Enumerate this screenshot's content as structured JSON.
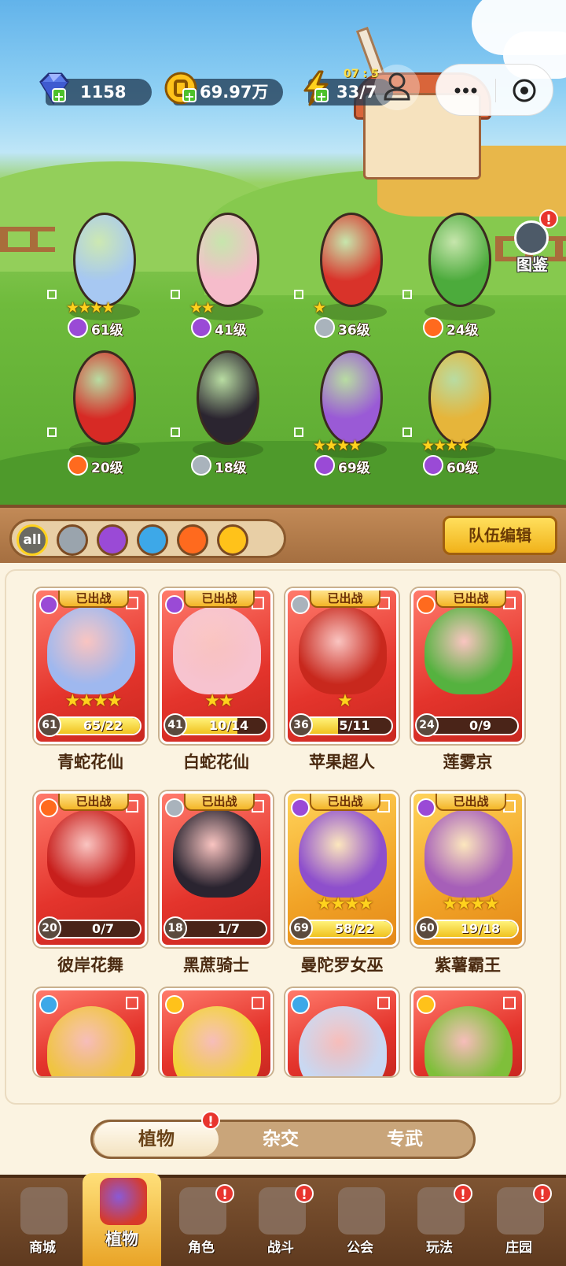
{
  "resources": {
    "gems": "1158",
    "gold": "69.97万",
    "stamina": "33/7",
    "stamina_timer": "07 : 5"
  },
  "codex": {
    "label": "图鉴",
    "badge": "!"
  },
  "lineup": [
    {
      "name": "青蛇花仙",
      "level": "61级",
      "stars": "★★★★",
      "element": "potion",
      "color": "#a7c8f2"
    },
    {
      "name": "白蛇花仙",
      "level": "41级",
      "stars": "★★",
      "element": "potion",
      "color": "#f6bccb"
    },
    {
      "name": "苹果超人",
      "level": "36级",
      "stars": "★",
      "element": "sword",
      "color": "#d9332a"
    },
    {
      "name": "莲雾京",
      "level": "24级",
      "stars": "",
      "element": "fire",
      "color": "#4cab3c"
    },
    {
      "name": "彼岸花舞",
      "level": "20级",
      "stars": "",
      "element": "fire",
      "color": "#d72a25"
    },
    {
      "name": "黑蔗骑士",
      "level": "18级",
      "stars": "",
      "element": "sword",
      "color": "#2b2530"
    },
    {
      "name": "曼陀罗女巫",
      "level": "69级",
      "stars": "★★★★",
      "element": "potion",
      "color": "#9a5ad6"
    },
    {
      "name": "紫薯霸王",
      "level": "60级",
      "stars": "★★★★",
      "element": "potion",
      "color": "#e6b53a"
    }
  ],
  "filters": [
    {
      "id": "all",
      "label": "all",
      "color": "#6b6a63"
    },
    {
      "id": "sword",
      "label": "",
      "color": "#9aa4ad"
    },
    {
      "id": "potion",
      "label": "",
      "color": "#9a4ad6"
    },
    {
      "id": "water",
      "label": "",
      "color": "#3da8e8"
    },
    {
      "id": "fire",
      "label": "",
      "color": "#ff6a1e"
    },
    {
      "id": "lightning",
      "label": "",
      "color": "#ffc21a"
    }
  ],
  "team_edit": "队伍编辑",
  "deployed_label": "已出战",
  "cards": [
    {
      "name": "青蛇花仙",
      "level": "61",
      "progress": "65/22",
      "fill": 1.0,
      "stars": "★★★★",
      "element": "potion",
      "bg": "red",
      "art": "#9fb8ef"
    },
    {
      "name": "白蛇花仙",
      "level": "41",
      "progress": "10/14",
      "fill": 0.71,
      "stars": "★★",
      "element": "potion",
      "bg": "red",
      "art": "#f7c3cf"
    },
    {
      "name": "苹果超人",
      "level": "36",
      "progress": "5/11",
      "fill": 0.45,
      "stars": "★",
      "element": "sword",
      "bg": "red",
      "art": "#c8281d"
    },
    {
      "name": "莲雾京",
      "level": "24",
      "progress": "0/9",
      "fill": 0.0,
      "stars": "",
      "element": "fire",
      "bg": "red",
      "art": "#55b23f"
    },
    {
      "name": "彼岸花舞",
      "level": "20",
      "progress": "0/7",
      "fill": 0.0,
      "stars": "",
      "element": "fire",
      "bg": "red",
      "art": "#c81f1c"
    },
    {
      "name": "黑蔗骑士",
      "level": "18",
      "progress": "1/7",
      "fill": 0.14,
      "stars": "",
      "element": "sword",
      "bg": "red",
      "art": "#2a2430"
    },
    {
      "name": "曼陀罗女巫",
      "level": "69",
      "progress": "58/22",
      "fill": 1.0,
      "stars": "★★★★",
      "element": "potion",
      "bg": "gold",
      "art": "#8e4fcc"
    },
    {
      "name": "紫薯霸王",
      "level": "60",
      "progress": "19/18",
      "fill": 1.0,
      "stars": "★★★★",
      "element": "potion",
      "bg": "gold",
      "art": "#a65fb8"
    },
    {
      "name": "",
      "level": "",
      "progress": "",
      "fill": 0,
      "stars": "",
      "element": "water",
      "bg": "red",
      "art": "#f0c442"
    },
    {
      "name": "",
      "level": "",
      "progress": "",
      "fill": 0,
      "stars": "",
      "element": "lightning",
      "bg": "red",
      "art": "#f2d23a"
    },
    {
      "name": "",
      "level": "",
      "progress": "",
      "fill": 0,
      "stars": "",
      "element": "water",
      "bg": "red",
      "art": "#c9d8f2"
    },
    {
      "name": "",
      "level": "",
      "progress": "",
      "fill": 0,
      "stars": "",
      "element": "lightning",
      "bg": "red",
      "art": "#7fbf3a"
    }
  ],
  "tabs": [
    {
      "label": "植物",
      "active": true,
      "badge": "!"
    },
    {
      "label": "杂交",
      "active": false,
      "badge": ""
    },
    {
      "label": "专武",
      "active": false,
      "badge": ""
    }
  ],
  "nav": [
    {
      "label": "商城",
      "icon": "shop-icon",
      "active": false,
      "badge": ""
    },
    {
      "label": "植物",
      "icon": "plant-icon",
      "active": true,
      "badge": ""
    },
    {
      "label": "角色",
      "icon": "character-icon",
      "active": false,
      "badge": "!"
    },
    {
      "label": "战斗",
      "icon": "battle-icon",
      "active": false,
      "badge": "!"
    },
    {
      "label": "公会",
      "icon": "guild-icon",
      "active": false,
      "badge": ""
    },
    {
      "label": "玩法",
      "icon": "gameplay-icon",
      "active": false,
      "badge": "!"
    },
    {
      "label": "庄园",
      "icon": "manor-icon",
      "active": false,
      "badge": "!"
    }
  ],
  "element_colors": {
    "potion": "#9a4ad6",
    "sword": "#a9b3bc",
    "fire": "#ff6a1e",
    "water": "#3da8e8",
    "lightning": "#ffc21a"
  }
}
